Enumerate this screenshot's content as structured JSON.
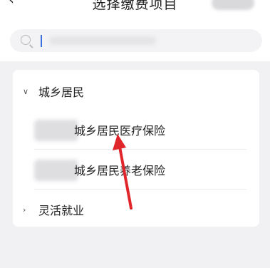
{
  "header": {
    "title": "选择缴费项目",
    "back_icon": "chevron-left-icon"
  },
  "search": {
    "placeholder": "",
    "icon": "search-icon"
  },
  "list": {
    "groups": [
      {
        "label": "城乡居民",
        "expanded": true,
        "items": [
          {
            "label": "城乡居民医疗保险"
          },
          {
            "label": "城乡居民养老保险"
          }
        ]
      },
      {
        "label": "灵活就业",
        "expanded": false,
        "items": []
      }
    ]
  },
  "annotation": {
    "arrow_color": "#e0262b"
  }
}
